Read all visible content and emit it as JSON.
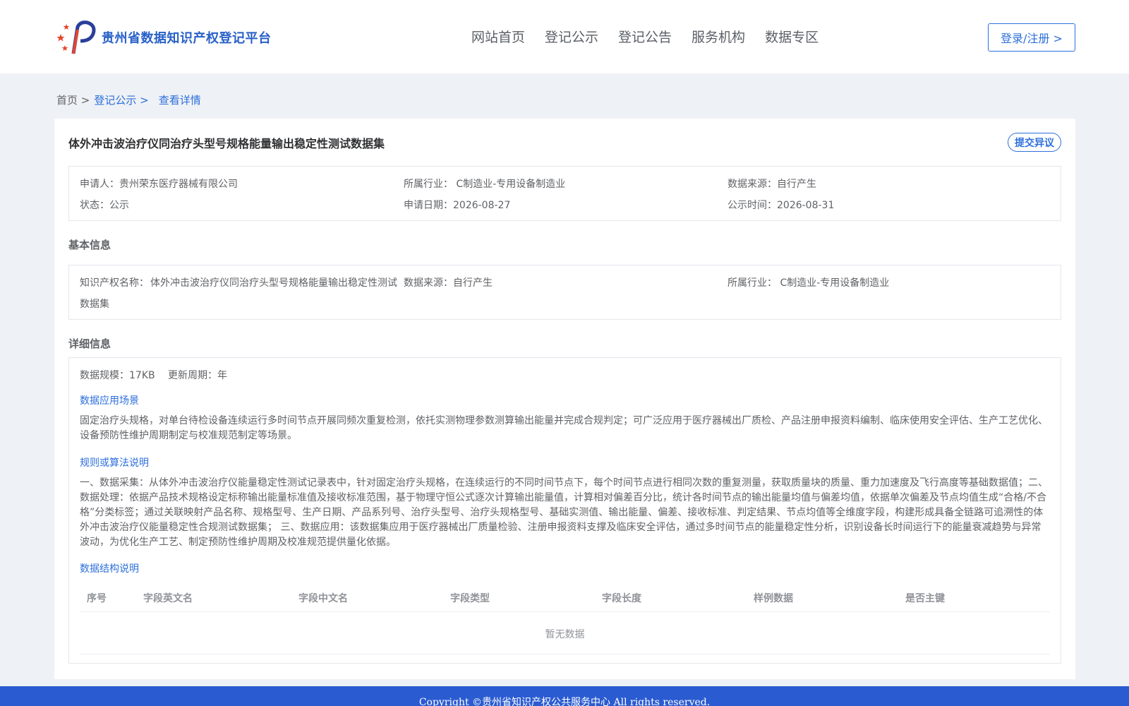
{
  "header": {
    "site_title": "贵州省数据知识产权登记平台",
    "nav": [
      "网站首页",
      "登记公示",
      "登记公告",
      "服务机构",
      "数据专区"
    ],
    "login_label": "登录/注册 >"
  },
  "breadcrumb": {
    "home": "首页 >",
    "list": "登记公示 >",
    "current": "查看详情"
  },
  "record": {
    "title": "体外冲击波治疗仪同治疗头型号规格能量输出稳定性测试数据集",
    "objection_label": "提交异议",
    "summary": {
      "applicant": "申请人：贵州荣东医疗器械有限公司",
      "industry": "所属行业： C制造业-专用设备制造业",
      "source": "数据来源：自行产生",
      "status": "状态：公示",
      "apply_date": "申请日期：2026-08-27",
      "publish_date": "公示时间：2026-08-31"
    }
  },
  "basic": {
    "section_title": "基本信息",
    "name_label": "知识产权名称：",
    "name_line1": "体外冲击波治疗仪同治疗头型号规格能量输出稳定性测试",
    "name_line2": "数据集",
    "source": "数据来源：自行产生",
    "industry": "所属行业： C制造业-专用设备制造业"
  },
  "detail": {
    "section_title": "详细信息",
    "scale": "数据规模：17KB",
    "cycle": "更新周期：年",
    "scene_title": "数据应用场景",
    "scene_text": "固定治疗头规格，对单台待检设备连续运行多时间节点开展同频次重复检测，依托实测物理参数测算输出能量并完成合规判定；可广泛应用于医疗器械出厂质检、产品注册申报资料编制、临床使用安全评估、生产工艺优化、设备预防性维护周期制定与校准规范制定等场景。",
    "rule_title": "规则或算法说明",
    "rule_text": "一、数据采集：从体外冲击波治疗仪能量稳定性测试记录表中，针对固定治疗头规格，在连续运行的不同时间节点下，每个时间节点进行相同次数的重复测量，获取质量块的质量、重力加速度及飞行高度等基础数据值；二、数据处理：依据产品技术规格设定标称输出能量标准值及接收标准范围，基于物理守恒公式逐次计算输出能量值，计算相对偏差百分比，统计各时间节点的输出能量均值与偏差均值，依据单次偏差及节点均值生成“合格/不合格”分类标签；通过关联映射产品名称、规格型号、生产日期、产品系列号、治疗头型号、治疗头规格型号、基础实测值、输出能量、偏差、接收标准、判定结果、节点均值等全维度字段，构建形成具备全链路可追溯性的体外冲击波治疗仪能量稳定性合规测试数据集； 三、数据应用：该数据集应用于医疗器械出厂质量检验、注册申报资料支撑及临床安全评估，通过多时间节点的能量稳定性分析，识别设备长时间运行下的能量衰减趋势与异常波动，为优化生产工艺、制定预防性维护周期及校准规范提供量化依据。",
    "struct_title": "数据结构说明",
    "table_headers": [
      "序号",
      "字段英文名",
      "字段中文名",
      "字段类型",
      "字段长度",
      "样例数据",
      "是否主键"
    ],
    "empty_text": "暂无数据"
  },
  "footer": {
    "copyright": "Copyright ©贵州省知识产权公共服务中心 All rights reserved."
  },
  "colors": {
    "brand_blue": "#2d6fdb",
    "footer_blue": "#2a5bd1",
    "logo_red": "#e8452c"
  }
}
